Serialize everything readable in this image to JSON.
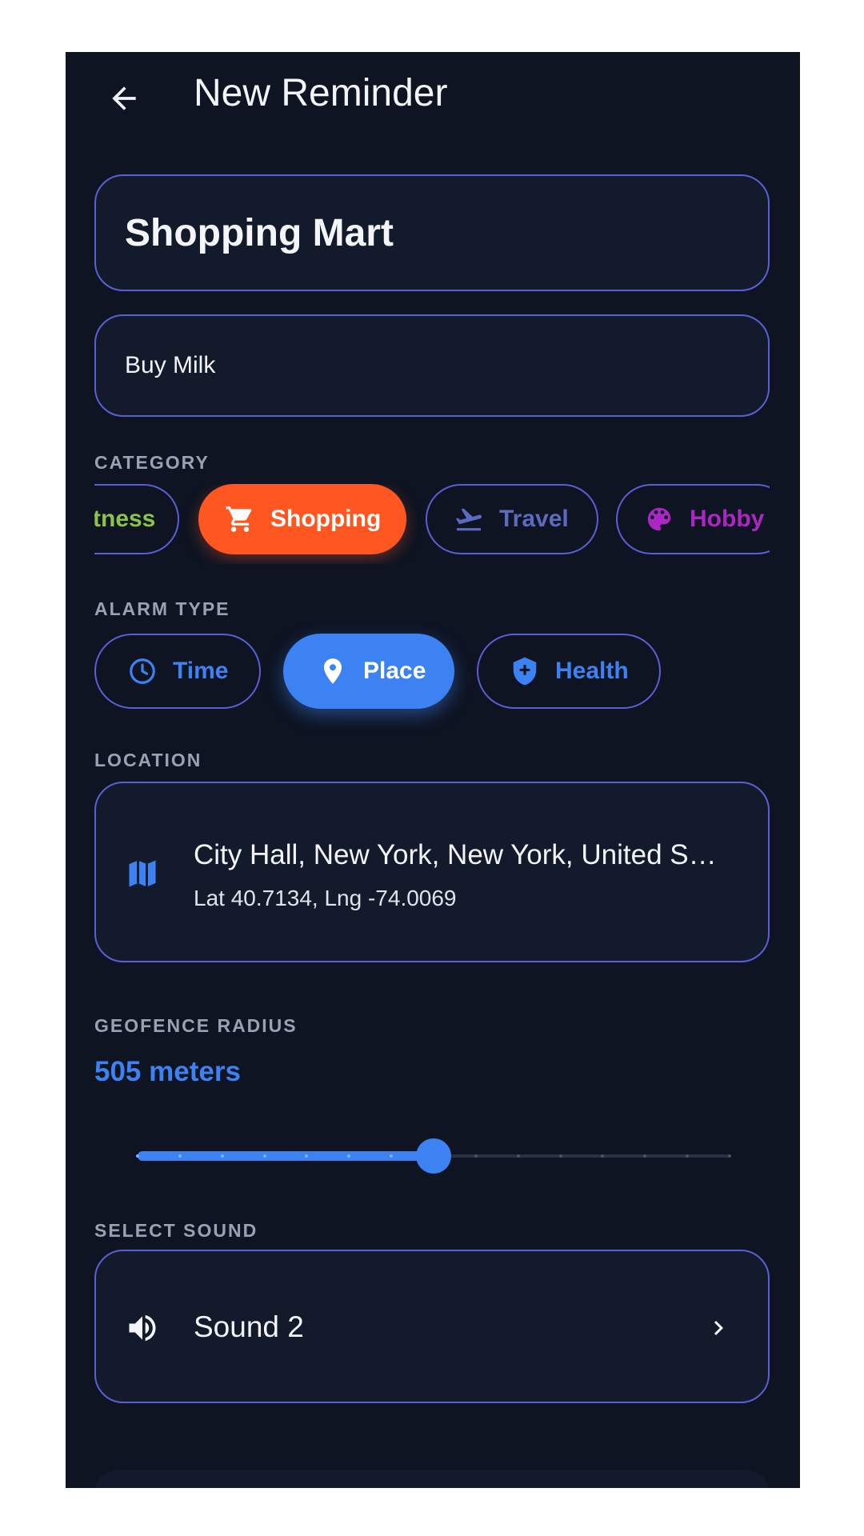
{
  "header": {
    "title": "New Reminder"
  },
  "form": {
    "title_value": "Shopping Mart",
    "note_value": "Buy Milk"
  },
  "category": {
    "label": "CATEGORY",
    "chips": [
      {
        "label": "tness",
        "icon": "none",
        "selected": false,
        "color": "#8bc34a"
      },
      {
        "label": "Shopping",
        "icon": "cart-icon",
        "selected": true,
        "color": "#ff5722"
      },
      {
        "label": "Travel",
        "icon": "flight-takeoff-icon",
        "selected": false,
        "color": "#5c6bc0"
      },
      {
        "label": "Hobby",
        "icon": "palette-icon",
        "selected": false,
        "color": "#ab27c4"
      }
    ]
  },
  "alarm_type": {
    "label": "ALARM TYPE",
    "options": [
      {
        "label": "Time",
        "icon": "clock-icon",
        "selected": false
      },
      {
        "label": "Place",
        "icon": "location-pin-icon",
        "selected": true
      },
      {
        "label": "Health",
        "icon": "shield-plus-icon",
        "selected": false
      }
    ]
  },
  "location": {
    "label": "LOCATION",
    "name": "City Hall, New York, New York, United S…",
    "coords": "Lat 40.7134, Lng -74.0069",
    "icon": "map-icon"
  },
  "geofence": {
    "label": "GEOFENCE RADIUS",
    "value_text": "505 meters",
    "slider_fraction": 0.5,
    "steps": 14
  },
  "sound": {
    "label": "SELECT SOUND",
    "value": "Sound 2",
    "icon": "volume-icon"
  },
  "colors": {
    "accent": "#3d82f2",
    "border": "#5b5fd6",
    "background": "#0e1422",
    "shopping": "#ff5722"
  }
}
